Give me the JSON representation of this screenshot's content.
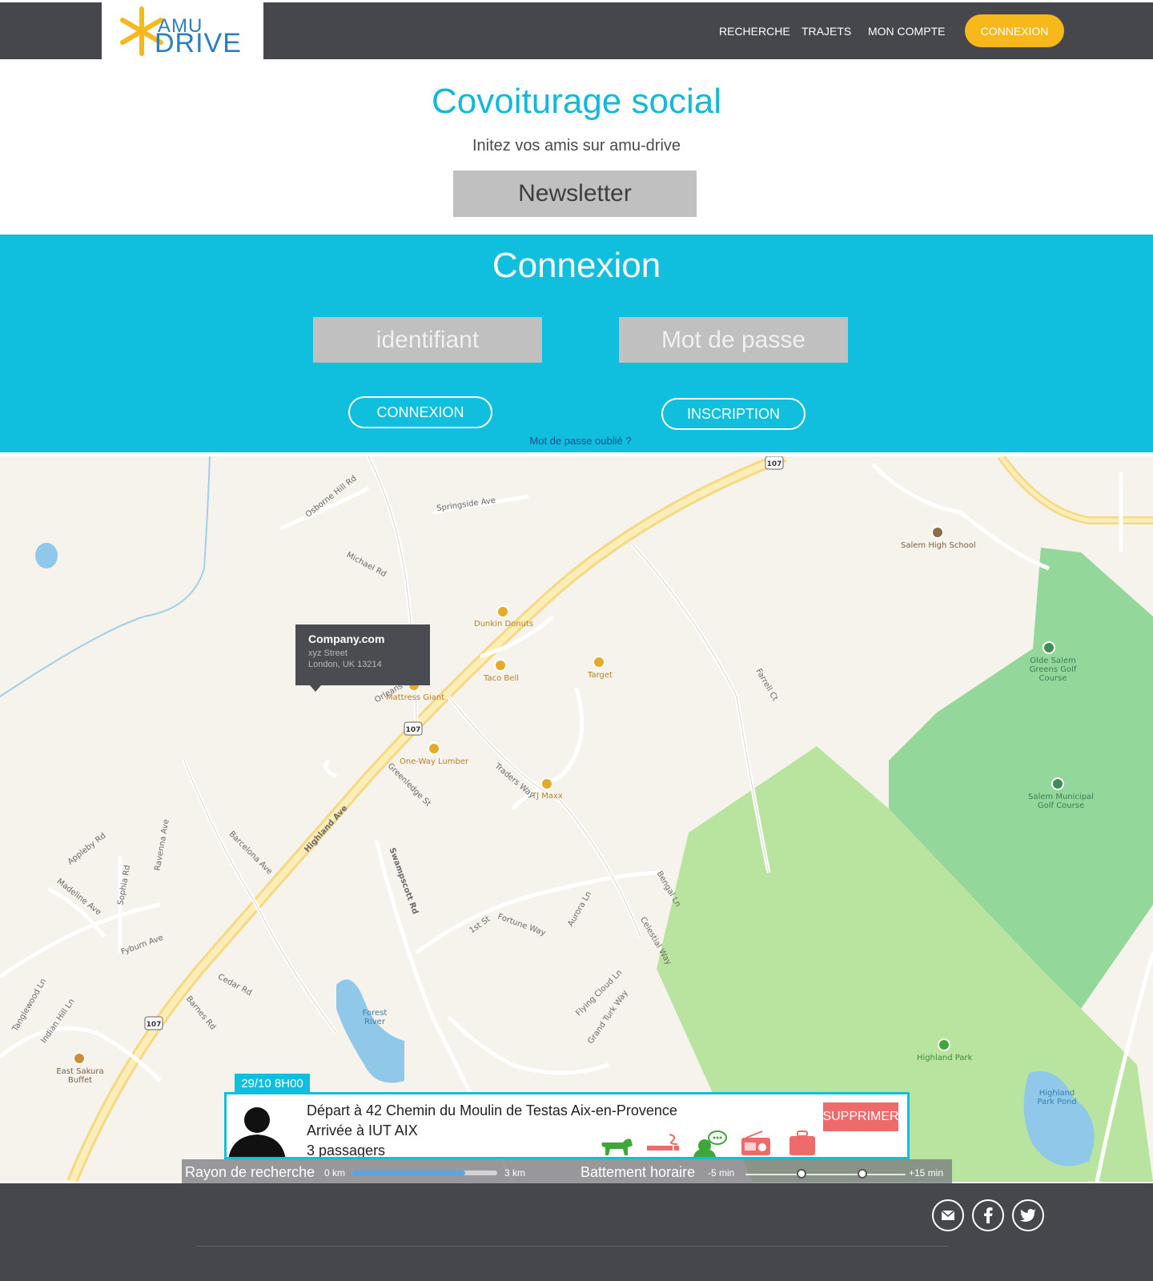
{
  "header": {
    "logo": {
      "line1": "AMU",
      "line2": "DRIVE"
    },
    "nav": [
      "RECHERCHE",
      "TRAJETS",
      "MON COMPTE"
    ],
    "cta": "CONNEXION"
  },
  "hero": {
    "title": "Covoiturage social",
    "subtitle": "Initez vos amis sur amu-drive",
    "newsletter": "Newsletter"
  },
  "login": {
    "title": "Connexion",
    "identifier": "identifiant",
    "password": "Mot de passe",
    "connect": "CONNEXION",
    "signup": "INSCRIPTION",
    "forgot": "Mot de passe oublié ?"
  },
  "map": {
    "tooltip": {
      "name": "Company.com",
      "street": "xyz Street",
      "city": "London, UK 13214"
    },
    "places": [
      "Dunkin Donuts",
      "Taco Bell",
      "Target",
      "Mattress Giant",
      "One-Way Lumber",
      "TJ Maxx",
      "Salem High School",
      "Olde Salem Greens Golf Course",
      "Salem Municipal Golf Course",
      "Highland Park",
      "Highland Park Pond",
      "East Sakura Buffet",
      "Forest River"
    ],
    "streets": [
      "Highland Ave",
      "Swampscott Rd",
      "Greenledge St",
      "Traders Way",
      "Springside Ave",
      "Osborne Hill Rd",
      "Michael Rd",
      "Barcelona Ave",
      "Appleby Rd",
      "Madeline Ave",
      "Fyburn Ave",
      "Cedar Rd",
      "Barnes Rd",
      "Fortune Way",
      "Aurora Ln",
      "Celestial Way",
      "Flying Cloud Ln",
      "Grand Turk Way",
      "Bengal Ln",
      "Tanglewood Ln",
      "Indian Hill Ln",
      "Sophia Rd",
      "Ravenna Ave",
      "Orleans Ave",
      "Farrell Ct",
      "1st St"
    ],
    "route_shield": "107"
  },
  "ride": {
    "date": "29/10  8H00",
    "depart": "Départ à 42 Chemin du Moulin de Testas Aix-en-Provence",
    "arrival": "Arrivée à IUT AIX",
    "passengers": "3 passagers",
    "delete": "SUPPRIMER",
    "preferences": [
      "animal-icon",
      "cigarette-icon",
      "chat-icon",
      "radio-icon",
      "luggage-icon"
    ],
    "pref_colors": {
      "animal": "#3fa63a",
      "smoke": "#ef6b6b",
      "chat": "#3fa63a",
      "radio": "#ef6b6b",
      "luggage": "#ef6b6b"
    }
  },
  "search": {
    "radius_label": "Rayon de recherche",
    "radius_min": "0 km",
    "radius_max": "3 km",
    "radius_value": 0.78,
    "window_label": "Battement horaire",
    "window_min": "-5 min",
    "window_max": "+15 min",
    "window_low": 0.35,
    "window_high": 0.73
  },
  "footer": {
    "social": [
      "mail-icon",
      "facebook-icon",
      "twitter-icon"
    ]
  },
  "colors": {
    "brand": "#10bedd",
    "accent": "#f6b81a",
    "dark": "#45474c",
    "danger": "#ef6b6b"
  }
}
